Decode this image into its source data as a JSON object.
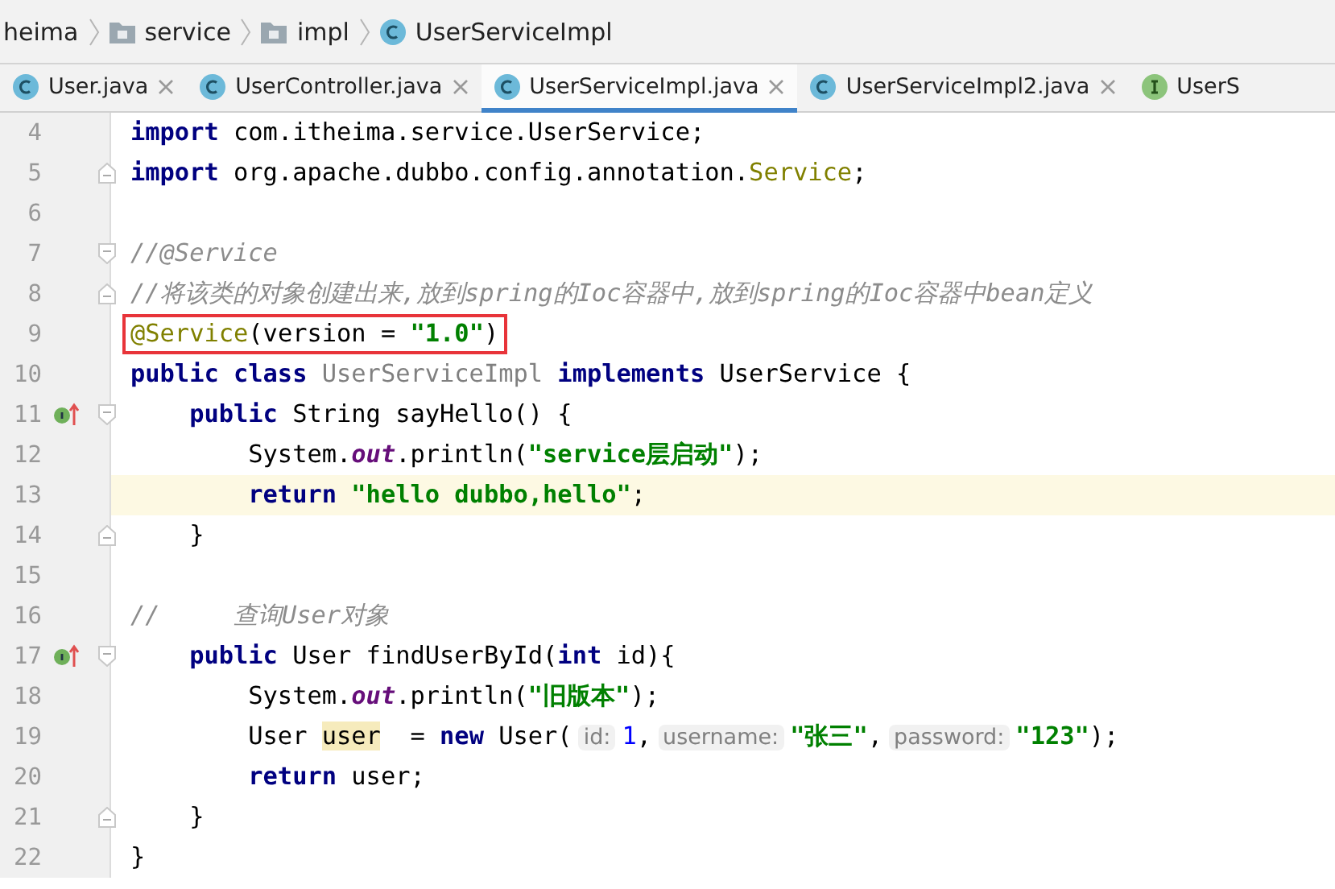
{
  "breadcrumb": [
    {
      "kind": "text",
      "label": "heima"
    },
    {
      "kind": "folder",
      "label": "service"
    },
    {
      "kind": "folder",
      "label": "impl"
    },
    {
      "kind": "class",
      "label": "UserServiceImpl"
    }
  ],
  "tabs": [
    {
      "kind": "class",
      "label": "User.java",
      "selected": false,
      "closable": true
    },
    {
      "kind": "class",
      "label": "UserController.java",
      "selected": false,
      "closable": true
    },
    {
      "kind": "class",
      "label": "UserServiceImpl.java",
      "selected": true,
      "closable": true
    },
    {
      "kind": "class",
      "label": "UserServiceImpl2.java",
      "selected": false,
      "closable": true
    },
    {
      "kind": "interface",
      "label": "UserS",
      "selected": false,
      "closable": false
    }
  ],
  "lines": [
    {
      "number": "4",
      "tokens": [
        {
          "kind": "kw",
          "text": "import"
        },
        {
          "kind": "plain",
          "text": " com.itheima.service.UserService;"
        }
      ]
    },
    {
      "number": "5",
      "gutter": [
        {
          "kind": "fold-end"
        }
      ],
      "tokens": [
        {
          "kind": "kw",
          "text": "import"
        },
        {
          "kind": "plain",
          "text": " org.apache.dubbo.config.annotation."
        },
        {
          "kind": "anno",
          "text": "Service"
        },
        {
          "kind": "plain",
          "text": ";"
        }
      ]
    },
    {
      "number": "6"
    },
    {
      "number": "7",
      "gutter": [
        {
          "kind": "fold-start"
        }
      ],
      "tokens": [
        {
          "kind": "comment",
          "text": "//@Service"
        }
      ]
    },
    {
      "number": "8",
      "gutter": [
        {
          "kind": "fold-end"
        }
      ],
      "tokens": [
        {
          "kind": "comment",
          "text": "//将该类的对象创建出来,放到spring的Ioc容器中,放到spring的Ioc容器中bean定义"
        }
      ]
    },
    {
      "number": "9",
      "boxed": true,
      "tokens": [
        {
          "kind": "anno",
          "text": "@Service"
        },
        {
          "kind": "plain",
          "text": "(version = "
        },
        {
          "kind": "str",
          "text": "\"1.0\""
        },
        {
          "kind": "plain",
          "text": ")"
        }
      ]
    },
    {
      "number": "10",
      "tokens": [
        {
          "kind": "kw",
          "text": "public class "
        },
        {
          "kind": "unused",
          "text": "UserServiceImpl"
        },
        {
          "kind": "kw",
          "text": " implements"
        },
        {
          "kind": "plain",
          "text": " UserService {"
        }
      ]
    },
    {
      "number": "11",
      "gutter": [
        {
          "kind": "implements"
        },
        {
          "kind": "fold-start"
        }
      ],
      "tokens": [
        {
          "kind": "kw",
          "text": "    public"
        },
        {
          "kind": "plain",
          "text": " String sayHello() {"
        }
      ]
    },
    {
      "number": "12",
      "tokens": [
        {
          "kind": "plain",
          "text": "        System."
        },
        {
          "kind": "field",
          "text": "out"
        },
        {
          "kind": "plain",
          "text": ".println("
        },
        {
          "kind": "str",
          "text": "\"service层启动\""
        },
        {
          "kind": "plain",
          "text": ");"
        }
      ]
    },
    {
      "number": "13",
      "current": true,
      "tokens": [
        {
          "kind": "kw",
          "text": "        return "
        },
        {
          "kind": "str",
          "text": "\"hello dubbo,hello\""
        },
        {
          "kind": "plain",
          "text": ";"
        }
      ]
    },
    {
      "number": "14",
      "gutter": [
        {
          "kind": "fold-end"
        }
      ],
      "tokens": [
        {
          "kind": "plain",
          "text": "    }"
        }
      ]
    },
    {
      "number": "15"
    },
    {
      "number": "16",
      "tokens": [
        {
          "kind": "comment",
          "text": "//     查询User对象"
        }
      ]
    },
    {
      "number": "17",
      "gutter": [
        {
          "kind": "implements"
        },
        {
          "kind": "fold-start"
        }
      ],
      "tokens": [
        {
          "kind": "kw",
          "text": "    public"
        },
        {
          "kind": "plain",
          "text": " User findUserById("
        },
        {
          "kind": "kw",
          "text": "int"
        },
        {
          "kind": "plain",
          "text": " id){"
        }
      ]
    },
    {
      "number": "18",
      "tokens": [
        {
          "kind": "plain",
          "text": "        System."
        },
        {
          "kind": "field",
          "text": "out"
        },
        {
          "kind": "plain",
          "text": ".println("
        },
        {
          "kind": "str",
          "text": "\"旧版本\""
        },
        {
          "kind": "plain",
          "text": ");"
        }
      ]
    },
    {
      "number": "19",
      "tokens": [
        {
          "kind": "plain",
          "text": "        User "
        },
        {
          "kind": "usage",
          "text": "user"
        },
        {
          "kind": "plain",
          "text": "  = "
        },
        {
          "kind": "kw",
          "text": "new"
        },
        {
          "kind": "plain",
          "text": " User("
        },
        {
          "kind": "hint",
          "text": "id:"
        },
        {
          "kind": "num",
          "text": "1"
        },
        {
          "kind": "plain",
          "text": ","
        },
        {
          "kind": "hint",
          "text": "username:"
        },
        {
          "kind": "str",
          "text": "\"张三\""
        },
        {
          "kind": "plain",
          "text": ","
        },
        {
          "kind": "hint",
          "text": "password:"
        },
        {
          "kind": "str",
          "text": "\"123\""
        },
        {
          "kind": "plain",
          "text": ");"
        }
      ]
    },
    {
      "number": "20",
      "tokens": [
        {
          "kind": "kw",
          "text": "        return"
        },
        {
          "kind": "plain",
          "text": " user;"
        }
      ]
    },
    {
      "number": "21",
      "gutter": [
        {
          "kind": "fold-end"
        }
      ],
      "tokens": [
        {
          "kind": "plain",
          "text": "    }"
        }
      ]
    },
    {
      "number": "22",
      "tokens": [
        {
          "kind": "plain",
          "text": "}"
        }
      ]
    }
  ]
}
